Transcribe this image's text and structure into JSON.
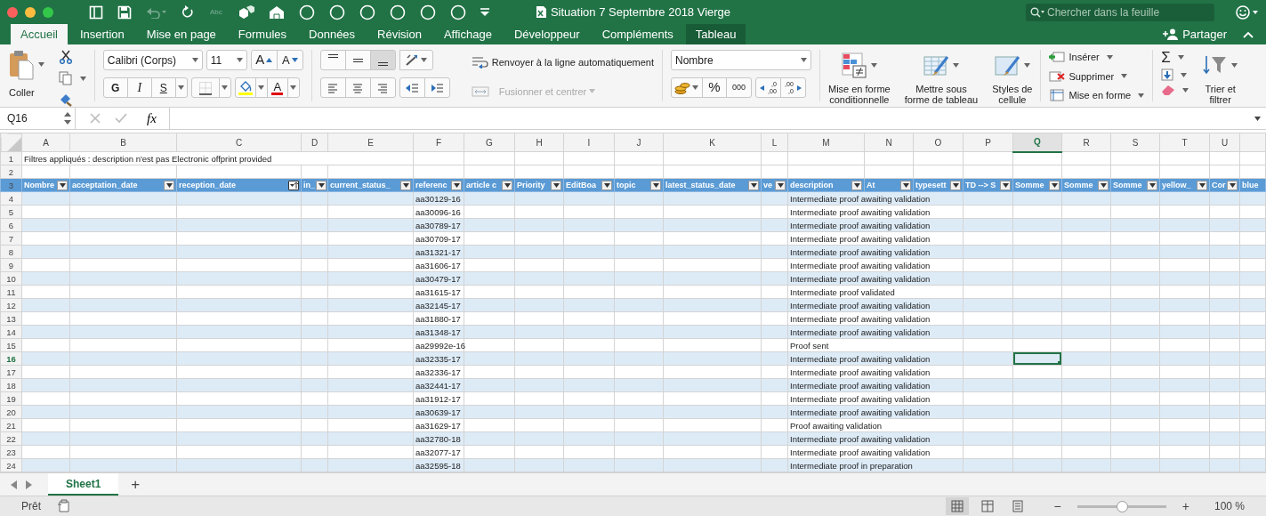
{
  "window": {
    "title": "Situation 7 Septembre 2018 Vierge",
    "controls": [
      {
        "color": "#fc605c"
      },
      {
        "color": "#fdbc40"
      },
      {
        "color": "#34c84a"
      }
    ]
  },
  "quick_access": [
    {
      "kind": "sidebar",
      "disabled": false
    },
    {
      "kind": "save",
      "disabled": false
    },
    {
      "kind": "undo",
      "disabled": true
    },
    {
      "kind": "redo",
      "disabled": false
    },
    {
      "kind": "spelling",
      "label": "Abc",
      "disabled": true
    },
    {
      "kind": "shapes",
      "disabled": false
    },
    {
      "kind": "house",
      "disabled": false
    },
    {
      "kind": "circle",
      "disabled": false
    },
    {
      "kind": "circle",
      "disabled": false
    },
    {
      "kind": "circle",
      "disabled": false
    },
    {
      "kind": "circle",
      "disabled": false
    },
    {
      "kind": "circle",
      "disabled": false
    },
    {
      "kind": "circle",
      "disabled": false
    },
    {
      "kind": "more",
      "disabled": false
    }
  ],
  "search": {
    "placeholder": "Chercher dans la feuille"
  },
  "tabs": [
    {
      "label": "Accueil",
      "selected": true,
      "contextual": false
    },
    {
      "label": "Insertion",
      "selected": false,
      "contextual": false
    },
    {
      "label": "Mise en page",
      "selected": false,
      "contextual": false
    },
    {
      "label": "Formules",
      "selected": false,
      "contextual": false
    },
    {
      "label": "Données",
      "selected": false,
      "contextual": false
    },
    {
      "label": "Révision",
      "selected": false,
      "contextual": false
    },
    {
      "label": "Affichage",
      "selected": false,
      "contextual": false
    },
    {
      "label": "Développeur",
      "selected": false,
      "contextual": false
    },
    {
      "label": "Compléments",
      "selected": false,
      "contextual": false
    },
    {
      "label": "Tableau",
      "selected": false,
      "contextual": true
    }
  ],
  "share": {
    "label": "Partager"
  },
  "ribbon": {
    "clipboard": {
      "paste": "Coller"
    },
    "font": {
      "name": "Calibri (Corps)",
      "size": "11",
      "size_buttons": [
        {
          "kind": "grow",
          "label": "A"
        },
        {
          "kind": "shrink",
          "label": "A"
        }
      ],
      "style_buttons": [
        {
          "kind": "bold",
          "label": "G"
        },
        {
          "kind": "italic",
          "label": "I"
        },
        {
          "kind": "underline",
          "label": "S"
        }
      ],
      "font_color": "A"
    },
    "alignment": {
      "vertical": [
        {
          "kind": "top",
          "selected": false
        },
        {
          "kind": "middle",
          "selected": false
        },
        {
          "kind": "bottom",
          "selected": true
        }
      ],
      "horizontal": [
        {
          "kind": "left"
        },
        {
          "kind": "center"
        },
        {
          "kind": "right"
        }
      ],
      "wrap": "Renvoyer à la ligne automatiquement",
      "merge": {
        "label": "Fusionner et centrer",
        "disabled": true
      }
    },
    "number": {
      "format": "Nombre",
      "percent": "%",
      "thousands": "000",
      "decimal_buttons": [
        {
          "kind": "increase",
          "upper": ",0",
          "lower": ",00"
        },
        {
          "kind": "decrease",
          "upper": ",00",
          "lower": ",0"
        }
      ]
    },
    "styles": [
      {
        "kind": "conditional",
        "lines": [
          "Mise en forme",
          "conditionnelle"
        ]
      },
      {
        "kind": "table",
        "lines": [
          "Mettre sous",
          "forme de tableau"
        ]
      },
      {
        "kind": "cell",
        "lines": [
          "Styles de",
          "cellule"
        ]
      }
    ],
    "cells": [
      {
        "kind": "insert",
        "label": "Insérer"
      },
      {
        "kind": "delete",
        "label": "Supprimer"
      },
      {
        "kind": "format",
        "label": "Mise en forme"
      }
    ],
    "editing": {
      "sum": "Σ",
      "sort": [
        "Trier et",
        "filtrer"
      ]
    }
  },
  "formula_bar": {
    "name_box": "Q16",
    "function_label": "fx"
  },
  "sheet": {
    "columns": [
      {
        "letter": "A",
        "selected": false
      },
      {
        "letter": "B",
        "selected": false
      },
      {
        "letter": "C",
        "selected": false
      },
      {
        "letter": "D",
        "selected": false
      },
      {
        "letter": "E",
        "selected": false
      },
      {
        "letter": "F",
        "selected": false
      },
      {
        "letter": "G",
        "selected": false
      },
      {
        "letter": "H",
        "selected": false
      },
      {
        "letter": "I",
        "selected": false
      },
      {
        "letter": "J",
        "selected": false
      },
      {
        "letter": "K",
        "selected": false
      },
      {
        "letter": "L",
        "selected": false
      },
      {
        "letter": "M",
        "selected": false
      },
      {
        "letter": "N",
        "selected": false
      },
      {
        "letter": "O",
        "selected": false
      },
      {
        "letter": "P",
        "selected": false
      },
      {
        "letter": "Q",
        "selected": true
      },
      {
        "letter": "R",
        "selected": false
      },
      {
        "letter": "S",
        "selected": false
      },
      {
        "letter": "T",
        "selected": false
      },
      {
        "letter": "U",
        "selected": false
      }
    ],
    "note_row": {
      "number": "1",
      "text": "Filtres appliqués :  description n'est pas Electronic offprint provided"
    },
    "blank_row": {
      "number": "2"
    },
    "header_row": {
      "number": "3",
      "headers": [
        {
          "label": "Nombre",
          "sorted": false
        },
        {
          "label": "acceptation_date",
          "sorted": false
        },
        {
          "label": "reception_date",
          "sorted": true
        },
        {
          "label": "in_",
          "sorted": false
        },
        {
          "label": "current_status_",
          "sorted": false
        },
        {
          "label": "referenc",
          "sorted": false
        },
        {
          "label": "article c",
          "sorted": false
        },
        {
          "label": "Priority",
          "sorted": false
        },
        {
          "label": "EditBoa",
          "sorted": false
        },
        {
          "label": "topic",
          "sorted": false
        },
        {
          "label": "latest_status_date",
          "sorted": false
        },
        {
          "label": "ve",
          "sorted": false
        },
        {
          "label": "description",
          "sorted": false
        },
        {
          "label": "At",
          "sorted": false
        },
        {
          "label": "typesett",
          "sorted": false
        },
        {
          "label": "TD --> S",
          "sorted": false
        },
        {
          "label": "Somme",
          "sorted": false
        },
        {
          "label": "Somme",
          "sorted": false
        },
        {
          "label": "Somme",
          "sorted": false
        },
        {
          "label": "yellow_",
          "sorted": false
        },
        {
          "label": "Cor",
          "sorted": false
        },
        {
          "label": "blue",
          "sorted": false
        }
      ]
    },
    "data_rows": [
      {
        "number": "4",
        "selected": false,
        "reference": "aa30129-16",
        "description": "Intermediate proof awaiting validation"
      },
      {
        "number": "5",
        "selected": false,
        "reference": "aa30096-16",
        "description": "Intermediate proof awaiting validation"
      },
      {
        "number": "6",
        "selected": false,
        "reference": "aa30789-17",
        "description": "Intermediate proof awaiting validation"
      },
      {
        "number": "7",
        "selected": false,
        "reference": "aa30709-17",
        "description": "Intermediate proof awaiting validation"
      },
      {
        "number": "8",
        "selected": false,
        "reference": "aa31321-17",
        "description": "Intermediate proof awaiting validation"
      },
      {
        "number": "9",
        "selected": false,
        "reference": "aa31606-17",
        "description": "Intermediate proof awaiting validation"
      },
      {
        "number": "10",
        "selected": false,
        "reference": "aa30479-17",
        "description": "Intermediate proof awaiting validation"
      },
      {
        "number": "11",
        "selected": false,
        "reference": "aa31615-17",
        "description": "Intermediate proof validated"
      },
      {
        "number": "12",
        "selected": false,
        "reference": "aa32145-17",
        "description": "Intermediate proof awaiting validation"
      },
      {
        "number": "13",
        "selected": false,
        "reference": "aa31880-17",
        "description": "Intermediate proof awaiting validation"
      },
      {
        "number": "14",
        "selected": false,
        "reference": "aa31348-17",
        "description": "Intermediate proof awaiting validation"
      },
      {
        "number": "15",
        "selected": false,
        "reference": "aa29992e-16",
        "description": "Proof sent"
      },
      {
        "number": "16",
        "selected": true,
        "reference": "aa32335-17",
        "description": "Intermediate proof awaiting validation"
      },
      {
        "number": "17",
        "selected": false,
        "reference": "aa32336-17",
        "description": "Intermediate proof awaiting validation"
      },
      {
        "number": "18",
        "selected": false,
        "reference": "aa32441-17",
        "description": "Intermediate proof awaiting validation"
      },
      {
        "number": "19",
        "selected": false,
        "reference": "aa31912-17",
        "description": "Intermediate proof awaiting validation"
      },
      {
        "number": "20",
        "selected": false,
        "reference": "aa30639-17",
        "description": "Intermediate proof awaiting validation"
      },
      {
        "number": "21",
        "selected": false,
        "reference": "aa31629-17",
        "description": "Proof awaiting validation"
      },
      {
        "number": "22",
        "selected": false,
        "reference": "aa32780-18",
        "description": "Intermediate proof awaiting validation"
      },
      {
        "number": "23",
        "selected": false,
        "reference": "aa32077-17",
        "description": "Intermediate proof awaiting validation"
      },
      {
        "number": "24",
        "selected": false,
        "reference": "aa32595-18",
        "description": "Intermediate proof in preparation"
      }
    ]
  },
  "sheet_tabs": [
    {
      "label": "Sheet1",
      "selected": true
    }
  ],
  "add_sheet": "+",
  "status_bar": {
    "status": "Prêt",
    "views": [
      {
        "kind": "normal",
        "selected": true
      },
      {
        "kind": "page_layout",
        "selected": false
      },
      {
        "kind": "page_break",
        "selected": false
      }
    ],
    "zoom": {
      "minus": "−",
      "plus": "+",
      "level": 0.5,
      "reading": "100 %"
    }
  }
}
